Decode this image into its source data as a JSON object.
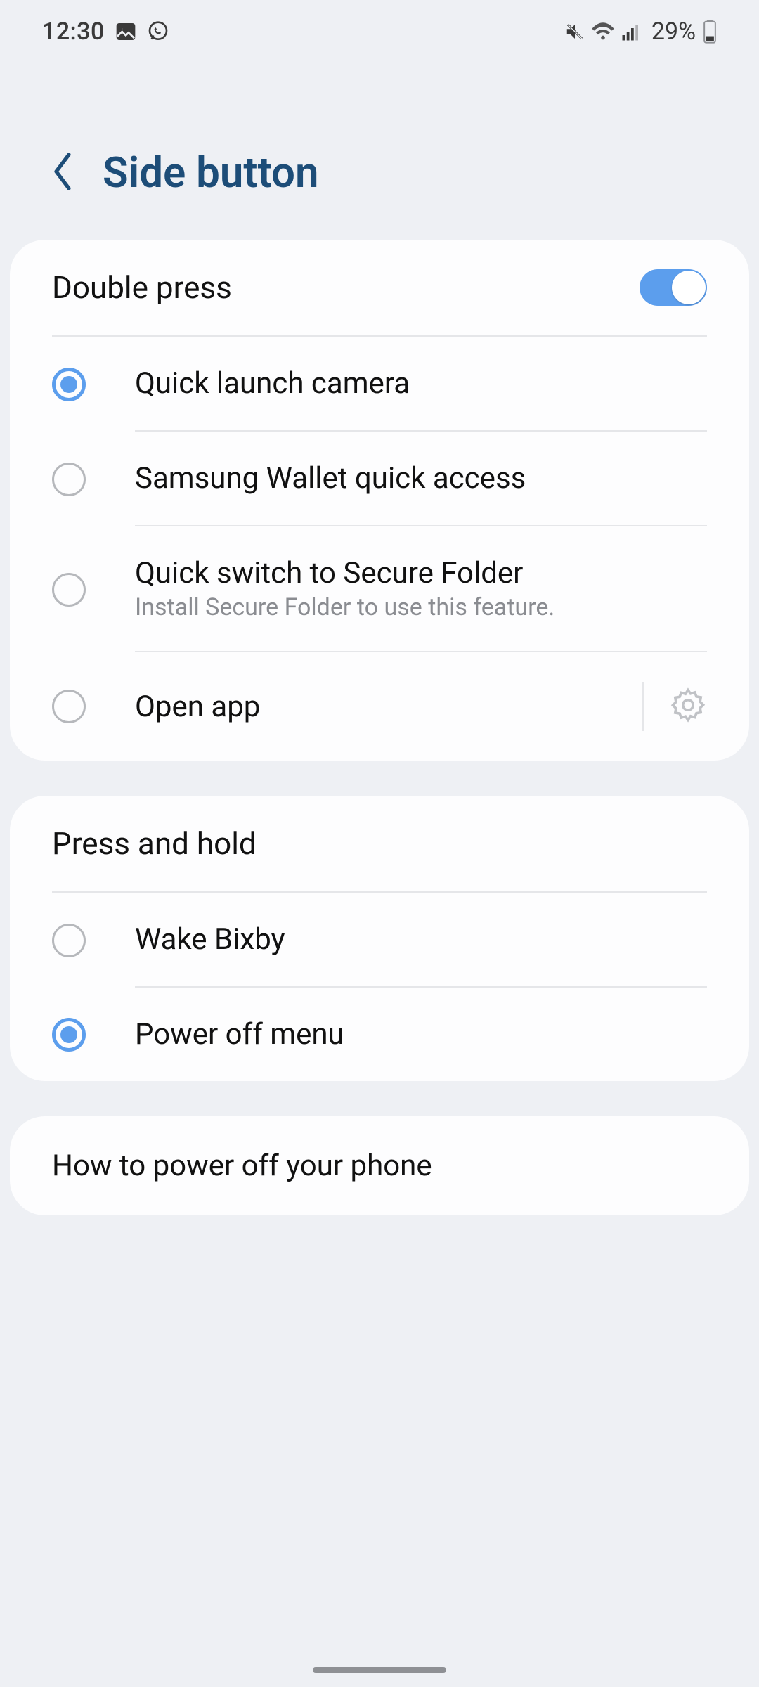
{
  "status": {
    "time": "12:30",
    "battery_text": "29%"
  },
  "header": {
    "title": "Side button"
  },
  "double_press": {
    "title": "Double press",
    "toggle_on": true,
    "options": [
      {
        "label": "Quick launch camera",
        "sub": "",
        "selected": true,
        "gear": false
      },
      {
        "label": "Samsung Wallet quick access",
        "sub": "",
        "selected": false,
        "gear": false
      },
      {
        "label": "Quick switch to Secure Folder",
        "sub": "Install Secure Folder to use this feature.",
        "selected": false,
        "gear": false
      },
      {
        "label": "Open app",
        "sub": "",
        "selected": false,
        "gear": true
      }
    ]
  },
  "press_hold": {
    "title": "Press and hold",
    "options": [
      {
        "label": "Wake Bixby",
        "selected": false
      },
      {
        "label": "Power off menu",
        "selected": true
      }
    ]
  },
  "how_to": {
    "label": "How to power off your phone"
  }
}
